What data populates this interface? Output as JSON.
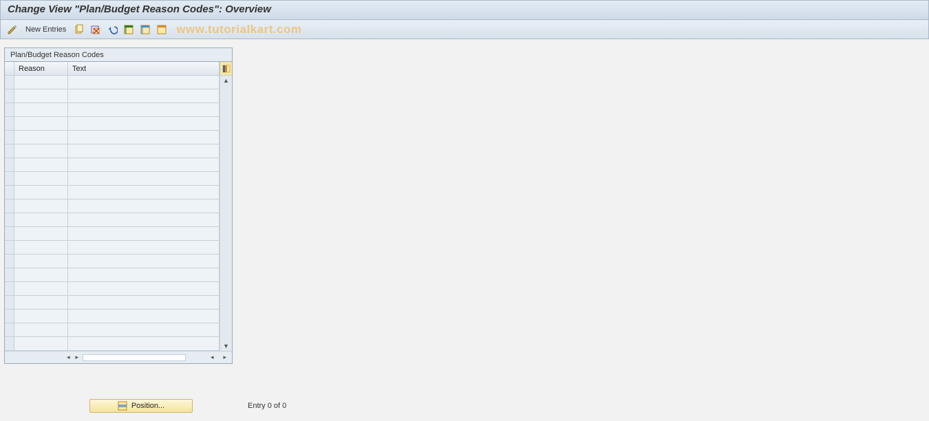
{
  "header": {
    "title": "Change View \"Plan/Budget Reason Codes\": Overview"
  },
  "toolbar": {
    "new_entries_label": "New Entries"
  },
  "watermark": "www.tutorialkart.com",
  "table": {
    "frame_title": "Plan/Budget Reason Codes",
    "columns": {
      "reason": "Reason",
      "text": "Text"
    },
    "row_count": 20
  },
  "footer": {
    "position_btn": "Position...",
    "entry_status": "Entry 0 of 0"
  }
}
